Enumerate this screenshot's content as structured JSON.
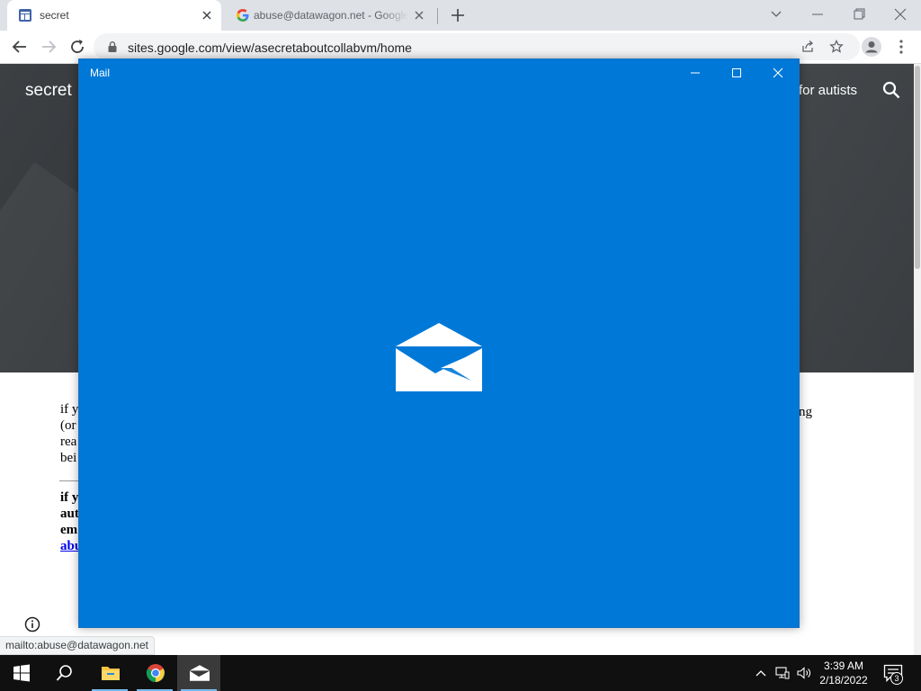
{
  "browser": {
    "tabs": [
      {
        "title": "secret",
        "active": true,
        "favicon": "google-sites-icon"
      },
      {
        "title": "abuse@datawagon.net - Google",
        "active": false,
        "favicon": "google-g-icon"
      }
    ],
    "address_bar": {
      "url": "sites.google.com/view/asecretaboutcollabvm/home"
    },
    "status_link": "mailto:abuse@datawagon.net"
  },
  "site": {
    "title": "secret",
    "nav_item": "for autists",
    "paragraph_fragments": [
      "if y",
      "(or",
      "rea",
      "bei"
    ],
    "bold_fragments": [
      "if y",
      "aut",
      "em"
    ],
    "link_fragment": "abu",
    "trailing_fragment": "ng"
  },
  "mail_window": {
    "title": "Mail",
    "background": "#0078d7",
    "splash_icon": "mail-envelope-icon"
  },
  "taskbar": {
    "pinned": [
      "start-icon",
      "search-icon",
      "file-explorer-icon",
      "chrome-icon",
      "mail-icon"
    ],
    "clock": {
      "time": "3:39 AM",
      "date": "2/18/2022"
    },
    "notification_count": "3"
  }
}
